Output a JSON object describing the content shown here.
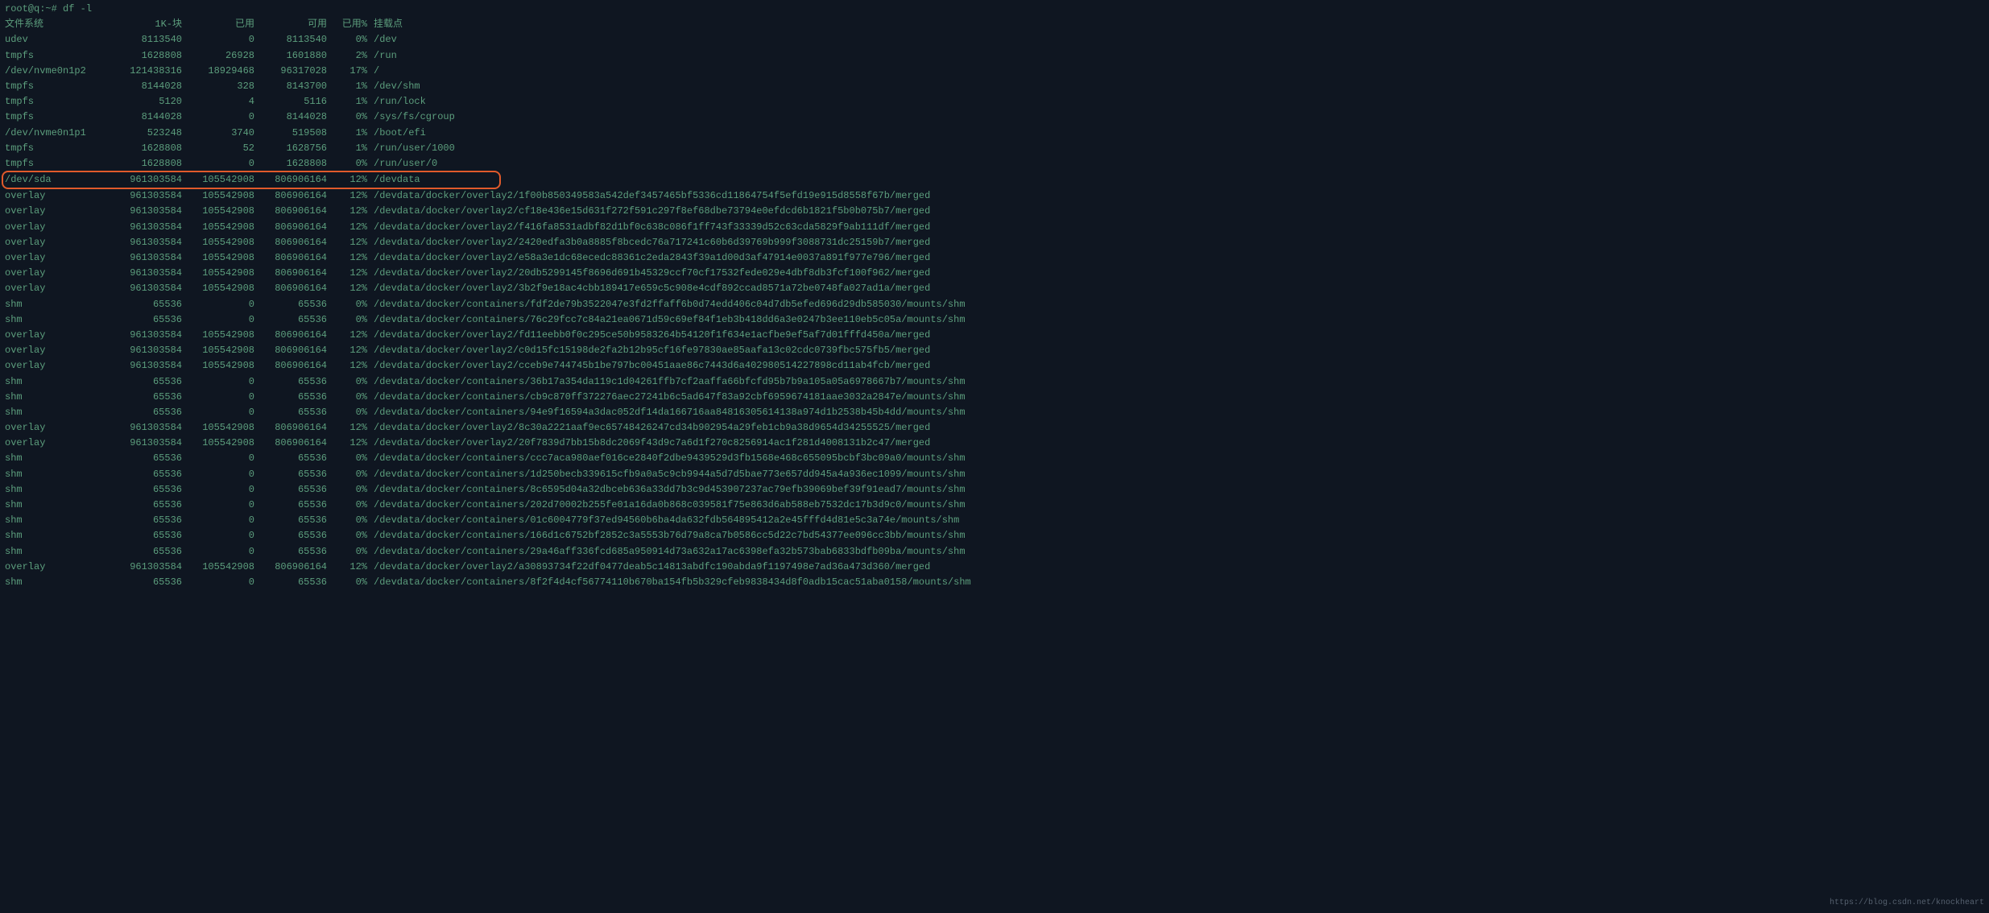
{
  "prompt": "root@q:~# df -l",
  "header": {
    "filesystem": "文件系统",
    "blocks": "1K-块",
    "used": "已用",
    "avail": "可用",
    "use_pct": "已用%",
    "mount": "挂载点"
  },
  "rows": [
    {
      "fs": "udev",
      "sz": "8113540",
      "us": "0",
      "av": "8113540",
      "pc": "0%",
      "mt": "/dev",
      "hl": false
    },
    {
      "fs": "tmpfs",
      "sz": "1628808",
      "us": "26928",
      "av": "1601880",
      "pc": "2%",
      "mt": "/run",
      "hl": false
    },
    {
      "fs": "/dev/nvme0n1p2",
      "sz": "121438316",
      "us": "18929468",
      "av": "96317028",
      "pc": "17%",
      "mt": "/",
      "hl": false
    },
    {
      "fs": "tmpfs",
      "sz": "8144028",
      "us": "328",
      "av": "8143700",
      "pc": "1%",
      "mt": "/dev/shm",
      "hl": false
    },
    {
      "fs": "tmpfs",
      "sz": "5120",
      "us": "4",
      "av": "5116",
      "pc": "1%",
      "mt": "/run/lock",
      "hl": false
    },
    {
      "fs": "tmpfs",
      "sz": "8144028",
      "us": "0",
      "av": "8144028",
      "pc": "0%",
      "mt": "/sys/fs/cgroup",
      "hl": false
    },
    {
      "fs": "/dev/nvme0n1p1",
      "sz": "523248",
      "us": "3740",
      "av": "519508",
      "pc": "1%",
      "mt": "/boot/efi",
      "hl": false
    },
    {
      "fs": "tmpfs",
      "sz": "1628808",
      "us": "52",
      "av": "1628756",
      "pc": "1%",
      "mt": "/run/user/1000",
      "hl": false
    },
    {
      "fs": "tmpfs",
      "sz": "1628808",
      "us": "0",
      "av": "1628808",
      "pc": "0%",
      "mt": "/run/user/0",
      "hl": false
    },
    {
      "fs": "/dev/sda",
      "sz": "961303584",
      "us": "105542908",
      "av": "806906164",
      "pc": "12%",
      "mt": "/devdata",
      "hl": true
    },
    {
      "fs": "overlay",
      "sz": "961303584",
      "us": "105542908",
      "av": "806906164",
      "pc": "12%",
      "mt": "/devdata/docker/overlay2/1f00b850349583a542def3457465bf5336cd11864754f5efd19e915d8558f67b/merged",
      "hl": false
    },
    {
      "fs": "overlay",
      "sz": "961303584",
      "us": "105542908",
      "av": "806906164",
      "pc": "12%",
      "mt": "/devdata/docker/overlay2/cf18e436e15d631f272f591c297f8ef68dbe73794e0efdcd6b1821f5b0b075b7/merged",
      "hl": false
    },
    {
      "fs": "overlay",
      "sz": "961303584",
      "us": "105542908",
      "av": "806906164",
      "pc": "12%",
      "mt": "/devdata/docker/overlay2/f416fa8531adbf82d1bf0c638c086f1ff743f33339d52c63cda5829f9ab111df/merged",
      "hl": false
    },
    {
      "fs": "overlay",
      "sz": "961303584",
      "us": "105542908",
      "av": "806906164",
      "pc": "12%",
      "mt": "/devdata/docker/overlay2/2420edfa3b0a8885f8bcedc76a717241c60b6d39769b999f3088731dc25159b7/merged",
      "hl": false
    },
    {
      "fs": "overlay",
      "sz": "961303584",
      "us": "105542908",
      "av": "806906164",
      "pc": "12%",
      "mt": "/devdata/docker/overlay2/e58a3e1dc68ecedc88361c2eda2843f39a1d00d3af47914e0037a891f977e796/merged",
      "hl": false
    },
    {
      "fs": "overlay",
      "sz": "961303584",
      "us": "105542908",
      "av": "806906164",
      "pc": "12%",
      "mt": "/devdata/docker/overlay2/20db5299145f8696d691b45329ccf70cf17532fede029e4dbf8db3fcf100f962/merged",
      "hl": false
    },
    {
      "fs": "overlay",
      "sz": "961303584",
      "us": "105542908",
      "av": "806906164",
      "pc": "12%",
      "mt": "/devdata/docker/overlay2/3b2f9e18ac4cbb189417e659c5c908e4cdf892ccad8571a72be0748fa027ad1a/merged",
      "hl": false
    },
    {
      "fs": "shm",
      "sz": "65536",
      "us": "0",
      "av": "65536",
      "pc": "0%",
      "mt": "/devdata/docker/containers/fdf2de79b3522047e3fd2ffaff6b0d74edd406c04d7db5efed696d29db585030/mounts/shm",
      "hl": false
    },
    {
      "fs": "shm",
      "sz": "65536",
      "us": "0",
      "av": "65536",
      "pc": "0%",
      "mt": "/devdata/docker/containers/76c29fcc7c84a21ea0671d59c69ef84f1eb3b418dd6a3e0247b3ee110eb5c05a/mounts/shm",
      "hl": false
    },
    {
      "fs": "overlay",
      "sz": "961303584",
      "us": "105542908",
      "av": "806906164",
      "pc": "12%",
      "mt": "/devdata/docker/overlay2/fd11eebb0f0c295ce50b9583264b54120f1f634e1acfbe9ef5af7d01fffd450a/merged",
      "hl": false
    },
    {
      "fs": "overlay",
      "sz": "961303584",
      "us": "105542908",
      "av": "806906164",
      "pc": "12%",
      "mt": "/devdata/docker/overlay2/c0d15fc15198de2fa2b12b95cf16fe97830ae85aafa13c02cdc0739fbc575fb5/merged",
      "hl": false
    },
    {
      "fs": "overlay",
      "sz": "961303584",
      "us": "105542908",
      "av": "806906164",
      "pc": "12%",
      "mt": "/devdata/docker/overlay2/cceb9e744745b1be797bc00451aae86c7443d6a402980514227898cd11ab4fcb/merged",
      "hl": false
    },
    {
      "fs": "shm",
      "sz": "65536",
      "us": "0",
      "av": "65536",
      "pc": "0%",
      "mt": "/devdata/docker/containers/36b17a354da119c1d04261ffb7cf2aaffa66bfcfd95b7b9a105a05a6978667b7/mounts/shm",
      "hl": false
    },
    {
      "fs": "shm",
      "sz": "65536",
      "us": "0",
      "av": "65536",
      "pc": "0%",
      "mt": "/devdata/docker/containers/cb9c870ff372276aec27241b6c5ad647f83a92cbf6959674181aae3032a2847e/mounts/shm",
      "hl": false
    },
    {
      "fs": "shm",
      "sz": "65536",
      "us": "0",
      "av": "65536",
      "pc": "0%",
      "mt": "/devdata/docker/containers/94e9f16594a3dac052df14da166716aa84816305614138a974d1b2538b45b4dd/mounts/shm",
      "hl": false
    },
    {
      "fs": "overlay",
      "sz": "961303584",
      "us": "105542908",
      "av": "806906164",
      "pc": "12%",
      "mt": "/devdata/docker/overlay2/8c30a2221aaf9ec65748426247cd34b902954a29feb1cb9a38d9654d34255525/merged",
      "hl": false
    },
    {
      "fs": "overlay",
      "sz": "961303584",
      "us": "105542908",
      "av": "806906164",
      "pc": "12%",
      "mt": "/devdata/docker/overlay2/20f7839d7bb15b8dc2069f43d9c7a6d1f270c8256914ac1f281d4008131b2c47/merged",
      "hl": false
    },
    {
      "fs": "shm",
      "sz": "65536",
      "us": "0",
      "av": "65536",
      "pc": "0%",
      "mt": "/devdata/docker/containers/ccc7aca980aef016ce2840f2dbe9439529d3fb1568e468c655095bcbf3bc09a0/mounts/shm",
      "hl": false
    },
    {
      "fs": "shm",
      "sz": "65536",
      "us": "0",
      "av": "65536",
      "pc": "0%",
      "mt": "/devdata/docker/containers/1d250becb339615cfb9a0a5c9cb9944a5d7d5bae773e657dd945a4a936ec1099/mounts/shm",
      "hl": false
    },
    {
      "fs": "shm",
      "sz": "65536",
      "us": "0",
      "av": "65536",
      "pc": "0%",
      "mt": "/devdata/docker/containers/8c6595d04a32dbceb636a33dd7b3c9d453907237ac79efb39069bef39f91ead7/mounts/shm",
      "hl": false
    },
    {
      "fs": "shm",
      "sz": "65536",
      "us": "0",
      "av": "65536",
      "pc": "0%",
      "mt": "/devdata/docker/containers/202d70002b255fe01a16da0b868c039581f75e863d6ab588eb7532dc17b3d9c0/mounts/shm",
      "hl": false
    },
    {
      "fs": "shm",
      "sz": "65536",
      "us": "0",
      "av": "65536",
      "pc": "0%",
      "mt": "/devdata/docker/containers/01c6004779f37ed94560b6ba4da632fdb564895412a2e45fffd4d81e5c3a74e/mounts/shm",
      "hl": false
    },
    {
      "fs": "shm",
      "sz": "65536",
      "us": "0",
      "av": "65536",
      "pc": "0%",
      "mt": "/devdata/docker/containers/166d1c6752bf2852c3a5553b76d79a8ca7b0586cc5d22c7bd54377ee096cc3bb/mounts/shm",
      "hl": false
    },
    {
      "fs": "shm",
      "sz": "65536",
      "us": "0",
      "av": "65536",
      "pc": "0%",
      "mt": "/devdata/docker/containers/29a46aff336fcd685a950914d73a632a17ac6398efa32b573bab6833bdfb09ba/mounts/shm",
      "hl": false
    },
    {
      "fs": "overlay",
      "sz": "961303584",
      "us": "105542908",
      "av": "806906164",
      "pc": "12%",
      "mt": "/devdata/docker/overlay2/a30893734f22df0477deab5c14813abdfc190abda9f1197498e7ad36a473d360/merged",
      "hl": false
    },
    {
      "fs": "shm",
      "sz": "65536",
      "us": "0",
      "av": "65536",
      "pc": "0%",
      "mt": "/devdata/docker/containers/8f2f4d4cf56774110b670ba154fb5b329cfeb9838434d8f0adb15cac51aba0158/mounts/shm",
      "hl": false
    }
  ],
  "watermark": "https://blog.csdn.net/knockheart"
}
